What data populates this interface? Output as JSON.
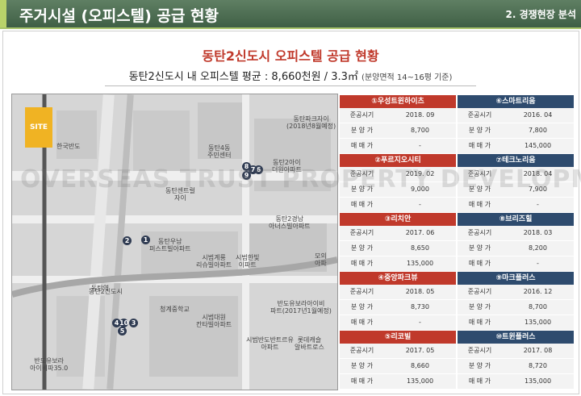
{
  "header": {
    "title": "주거시설 (오피스텔) 공급 현황",
    "section": "2. 경쟁현장 분석"
  },
  "main_title": "동탄2신도시 오피스텔 공급 현황",
  "subtitle": {
    "main": "동탄2신도시 내 오피스텔 평균 : 8,660천원 / 3.3㎡",
    "note": "(분양면적 14~16평 기준)"
  },
  "map": {
    "site_label": "SITE",
    "watermark": "OVERSEAS TRUST PROPERTY DEVELOPMENT",
    "labels": {
      "hantaek": "한국반도",
      "dongtan_station": "동탄역",
      "dongtan2": "동탄2신도시",
      "dongtan_yunam": "동탄우남\n퍼스트빌아파트",
      "sibeom_gyeryong": "시범계룡\n리슈빌아파트",
      "sibeom_hanbit": "시범한빛\n이파트",
      "cheonggye_mid": "청계중학교",
      "sibeom_daewoo": "시범대원\n칸타빌아파트",
      "sibeom_ban": "시범반도반트르유\n아파트",
      "dongtan_twin": "동탄파크자이\n(2018년8월예정)",
      "dongtan4": "동탄4동\n주민센터",
      "dongtan2_ij": "동탄2아이\n더원아파트",
      "dongtan_center": "동탄센트럴\n자이",
      "dongtan2_gyeongnam": "동탄2경남\n아너스빌아파트",
      "ban_river": "반도유보라아이비\n파트(2017년1월예정)",
      "lotte": "롯데캐슬\n알바트로스",
      "bando_yubora": "반도유보라\n아이비파35.0",
      "moui": "모의\n아파"
    },
    "markers": [
      "1",
      "2",
      "3",
      "4",
      "5",
      "6",
      "7",
      "8",
      "9",
      "10"
    ]
  },
  "competitors": [
    {
      "name": "①우성트윈하이츠",
      "color": "#c0392b",
      "rows": [
        [
          "준공시기",
          "2018. 09"
        ],
        [
          "분 양 가",
          "8,700"
        ],
        [
          "매 매 가",
          "-"
        ]
      ]
    },
    {
      "name": "⑥스마트리움",
      "color": "#2e4b6e",
      "rows": [
        [
          "준공시기",
          "2016. 04"
        ],
        [
          "분 양 가",
          "7,800"
        ],
        [
          "매 매 가",
          "145,000"
        ]
      ]
    },
    {
      "name": "②푸르지오시티",
      "color": "#c0392b",
      "rows": [
        [
          "준공시기",
          "2019. 02"
        ],
        [
          "분 양 가",
          "9,000"
        ],
        [
          "매 매 가",
          "-"
        ]
      ]
    },
    {
      "name": "⑦테크노리움",
      "color": "#2e4b6e",
      "rows": [
        [
          "준공시기",
          "2018. 04"
        ],
        [
          "분 양 가",
          "7,900"
        ],
        [
          "매 매 가",
          "-"
        ]
      ]
    },
    {
      "name": "③리치안",
      "color": "#c0392b",
      "rows": [
        [
          "준공시기",
          "2017. 06"
        ],
        [
          "분 양 가",
          "8,650"
        ],
        [
          "매 매 가",
          "135,000"
        ]
      ]
    },
    {
      "name": "⑧브리즈힐",
      "color": "#2e4b6e",
      "rows": [
        [
          "준공시기",
          "2018. 03"
        ],
        [
          "분 양 가",
          "8,200"
        ],
        [
          "매 매 가",
          "-"
        ]
      ]
    },
    {
      "name": "④중앙파크뷰",
      "color": "#c0392b",
      "rows": [
        [
          "준공시기",
          "2018. 05"
        ],
        [
          "분 양 가",
          "8,730"
        ],
        [
          "매 매 가",
          "-"
        ]
      ]
    },
    {
      "name": "⑨마크플러스",
      "color": "#2e4b6e",
      "rows": [
        [
          "준공시기",
          "2016. 12"
        ],
        [
          "분 양 가",
          "8,700"
        ],
        [
          "매 매 가",
          "135,000"
        ]
      ]
    },
    {
      "name": "⑤리코빌",
      "color": "#c0392b",
      "rows": [
        [
          "준공시기",
          "2017. 05"
        ],
        [
          "분 양 가",
          "8,660"
        ],
        [
          "매 매 가",
          "135,000"
        ]
      ]
    },
    {
      "name": "⑩트윈플러스",
      "color": "#2e4b6e",
      "rows": [
        [
          "준공시기",
          "2017. 08"
        ],
        [
          "분 양 가",
          "8,720"
        ],
        [
          "매 매 가",
          "135,000"
        ]
      ]
    }
  ]
}
